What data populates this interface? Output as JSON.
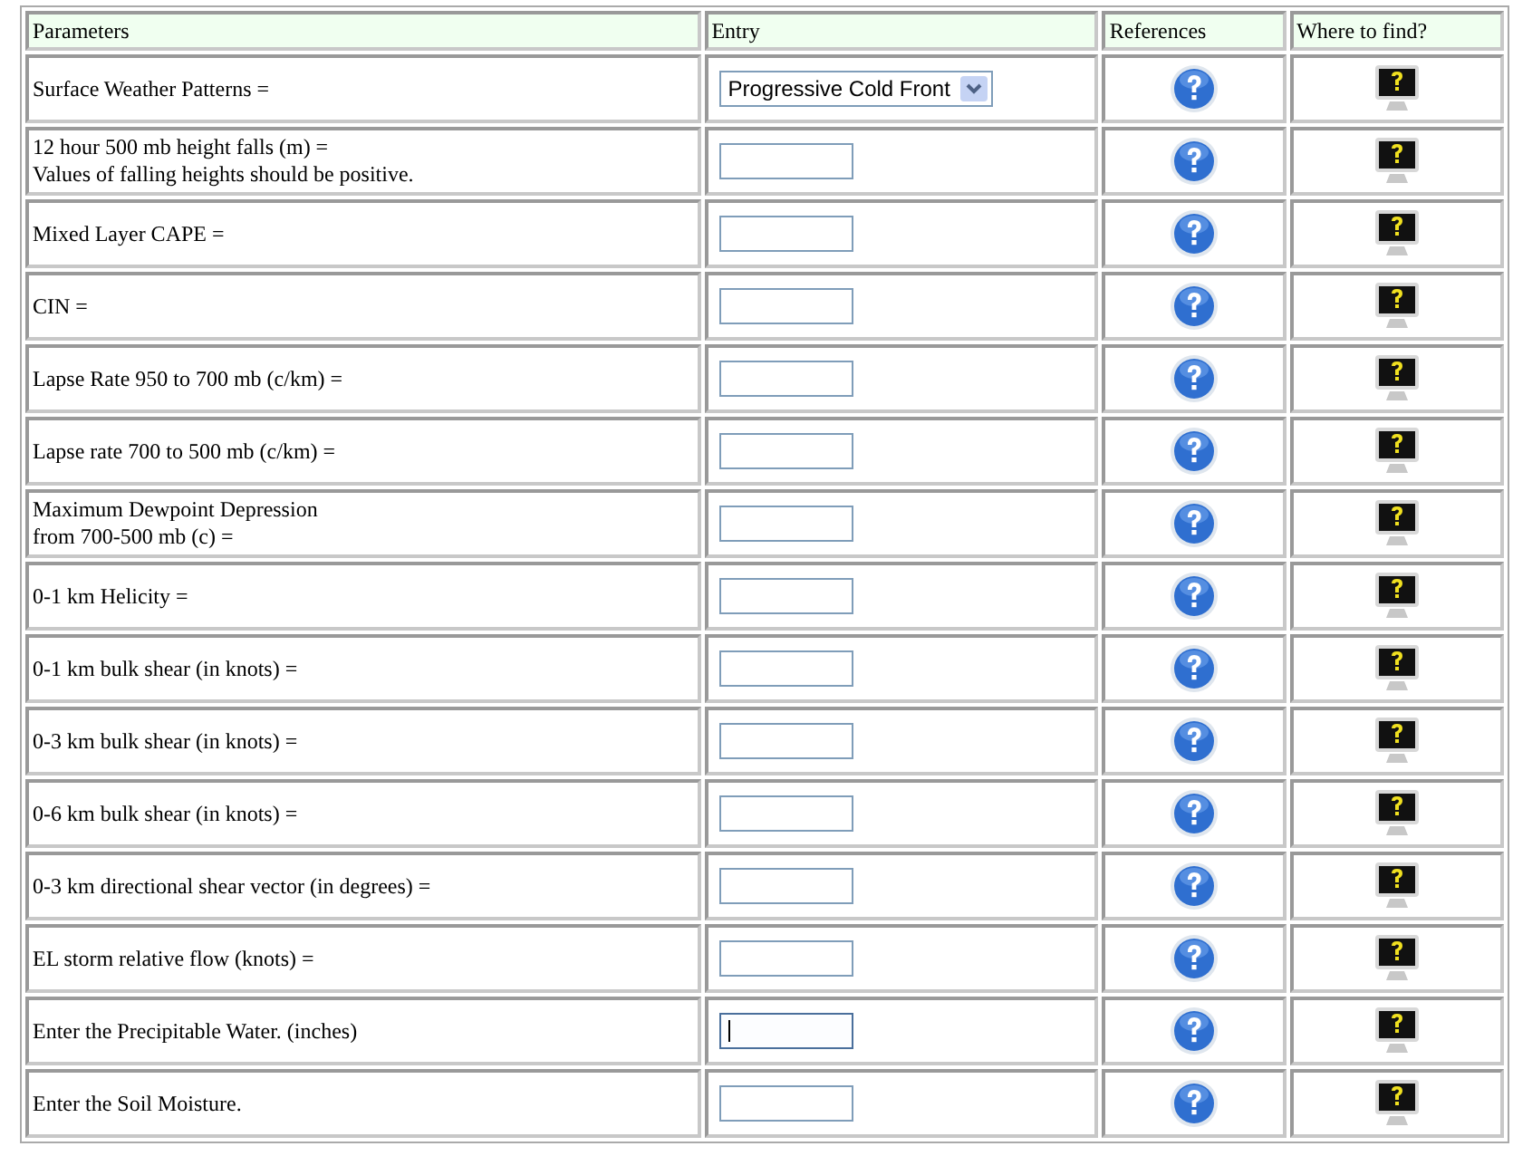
{
  "table": {
    "columns": [
      "Parameters",
      "Entry",
      "References",
      "Where to find?"
    ],
    "rows": [
      {
        "label": "Surface Weather Patterns =",
        "kind": "select",
        "value": "Progressive Cold Front"
      },
      {
        "label": "12 hour 500 mb height falls (m) =\nValues of falling heights should be positive.",
        "kind": "text",
        "value": "",
        "focused": false
      },
      {
        "label": "Mixed Layer CAPE =",
        "kind": "text",
        "value": "",
        "focused": false
      },
      {
        "label": "CIN =",
        "kind": "text",
        "value": "",
        "focused": false
      },
      {
        "label": "Lapse Rate 950 to 700 mb (c/km) =",
        "kind": "text",
        "value": "",
        "focused": false
      },
      {
        "label": "Lapse rate 700 to 500 mb (c/km) =",
        "kind": "text",
        "value": "",
        "focused": false
      },
      {
        "label": "Maximum Dewpoint Depression\nfrom 700-500 mb (c) =",
        "kind": "text",
        "value": "",
        "focused": false
      },
      {
        "label": "0-1 km Helicity =",
        "kind": "text",
        "value": "",
        "focused": false
      },
      {
        "label": "0-1 km bulk shear (in knots) =",
        "kind": "text",
        "value": "",
        "focused": false
      },
      {
        "label": "0-3 km bulk shear (in knots) =",
        "kind": "text",
        "value": "",
        "focused": false
      },
      {
        "label": "0-6 km bulk shear (in knots) =",
        "kind": "text",
        "value": "",
        "focused": false
      },
      {
        "label": "0-3 km directional shear vector (in degrees) =",
        "kind": "text",
        "value": "",
        "focused": false
      },
      {
        "label": "EL storm relative flow (knots) =",
        "kind": "text",
        "value": "",
        "focused": false
      },
      {
        "label": "Enter the Precipitable Water. (inches)",
        "kind": "text",
        "value": "",
        "focused": true
      },
      {
        "label": "Enter the Soil Moisture.",
        "kind": "text",
        "value": "",
        "focused": false
      }
    ]
  }
}
